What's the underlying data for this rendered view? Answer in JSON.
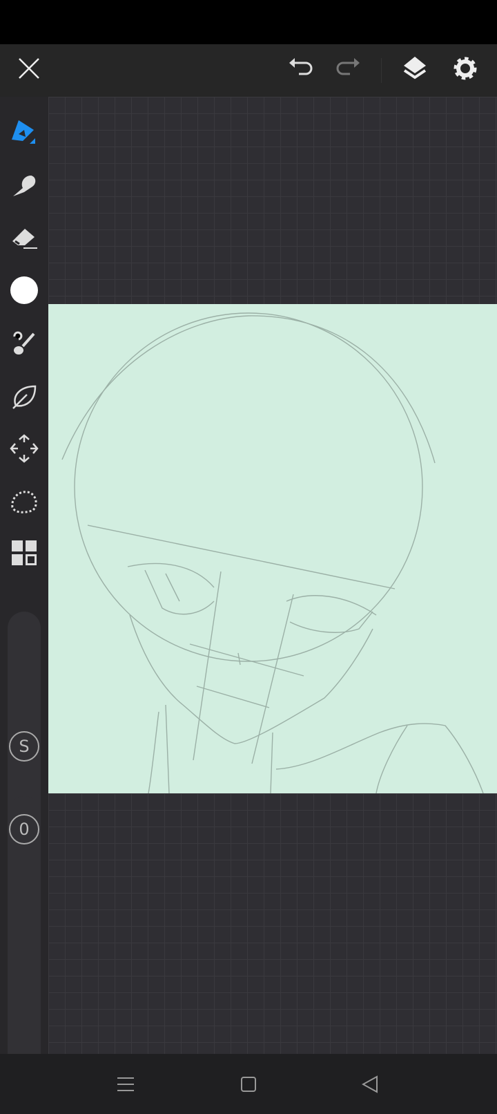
{
  "app": {
    "mode": "drawing-canvas"
  },
  "colors": {
    "accent": "#1e8ff0",
    "paper": "#d2eee0",
    "current_color": "#ffffff"
  },
  "toolbar": {
    "icons": [
      "close-icon",
      "undo-icon",
      "redo-icon",
      "layers-icon",
      "settings-icon"
    ]
  },
  "tools": [
    "pen",
    "finger-smudge",
    "eraser",
    "color",
    "brush-fill",
    "leaf-effect",
    "transform",
    "lasso-select",
    "more-grid"
  ],
  "sliders": {
    "size_label": "S",
    "opacity_label": "0"
  },
  "navbar": {
    "icons": [
      "menu-icon",
      "home-icon",
      "back-icon"
    ]
  }
}
